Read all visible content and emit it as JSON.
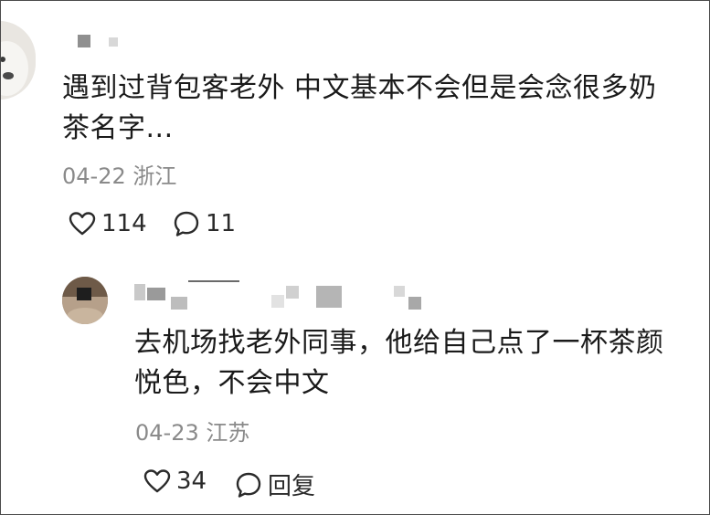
{
  "comments": [
    {
      "text_lines": [
        "遇到过背包客老外 中文基本不会但是会念很多奶",
        "茶名字..."
      ],
      "date": "04-22",
      "location": "浙江",
      "like_count": "114",
      "reply_count": "11"
    },
    {
      "text_lines": [
        "去机场找老外同事，他给自己点了一杯茶颜",
        "悦色，不会中文"
      ],
      "date": "04-23",
      "location": "江苏",
      "like_count": "34",
      "reply_label": "回复"
    }
  ],
  "icons": {
    "like": "heart-outline-icon",
    "reply": "speech-bubble-icon"
  }
}
